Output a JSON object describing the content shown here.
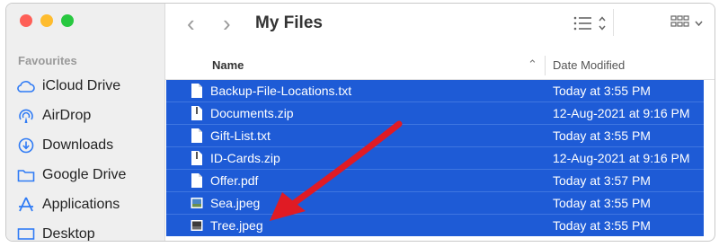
{
  "window": {
    "title": "My Files"
  },
  "sidebar": {
    "section_label": "Favourites",
    "items": [
      {
        "label": "iCloud Drive",
        "icon": "cloud-icon"
      },
      {
        "label": "AirDrop",
        "icon": "airdrop-icon"
      },
      {
        "label": "Downloads",
        "icon": "download-icon"
      },
      {
        "label": "Google Drive",
        "icon": "folder-icon"
      },
      {
        "label": "Applications",
        "icon": "applications-icon"
      },
      {
        "label": "Desktop",
        "icon": "desktop-icon"
      }
    ]
  },
  "columns": {
    "name": "Name",
    "date_modified": "Date Modified"
  },
  "files": [
    {
      "name": "Backup-File-Locations.txt",
      "date": "Today at 3:55 PM",
      "icon": "text-file-icon"
    },
    {
      "name": "Documents.zip",
      "date": "12-Aug-2021 at 9:16 PM",
      "icon": "zip-file-icon"
    },
    {
      "name": "Gift-List.txt",
      "date": "Today at 3:55 PM",
      "icon": "text-file-icon"
    },
    {
      "name": "ID-Cards.zip",
      "date": "12-Aug-2021 at 9:16 PM",
      "icon": "zip-file-icon"
    },
    {
      "name": "Offer.pdf",
      "date": "Today at 3:57 PM",
      "icon": "pdf-file-icon"
    },
    {
      "name": "Sea.jpeg",
      "date": "Today at 3:55 PM",
      "icon": "image-file-icon"
    },
    {
      "name": "Tree.jpeg",
      "date": "Today at 3:55 PM",
      "icon": "image-file-icon"
    }
  ],
  "colors": {
    "selection": "#1e5bd6",
    "arrow": "#e01b24",
    "accent": "#2f7bf5"
  }
}
